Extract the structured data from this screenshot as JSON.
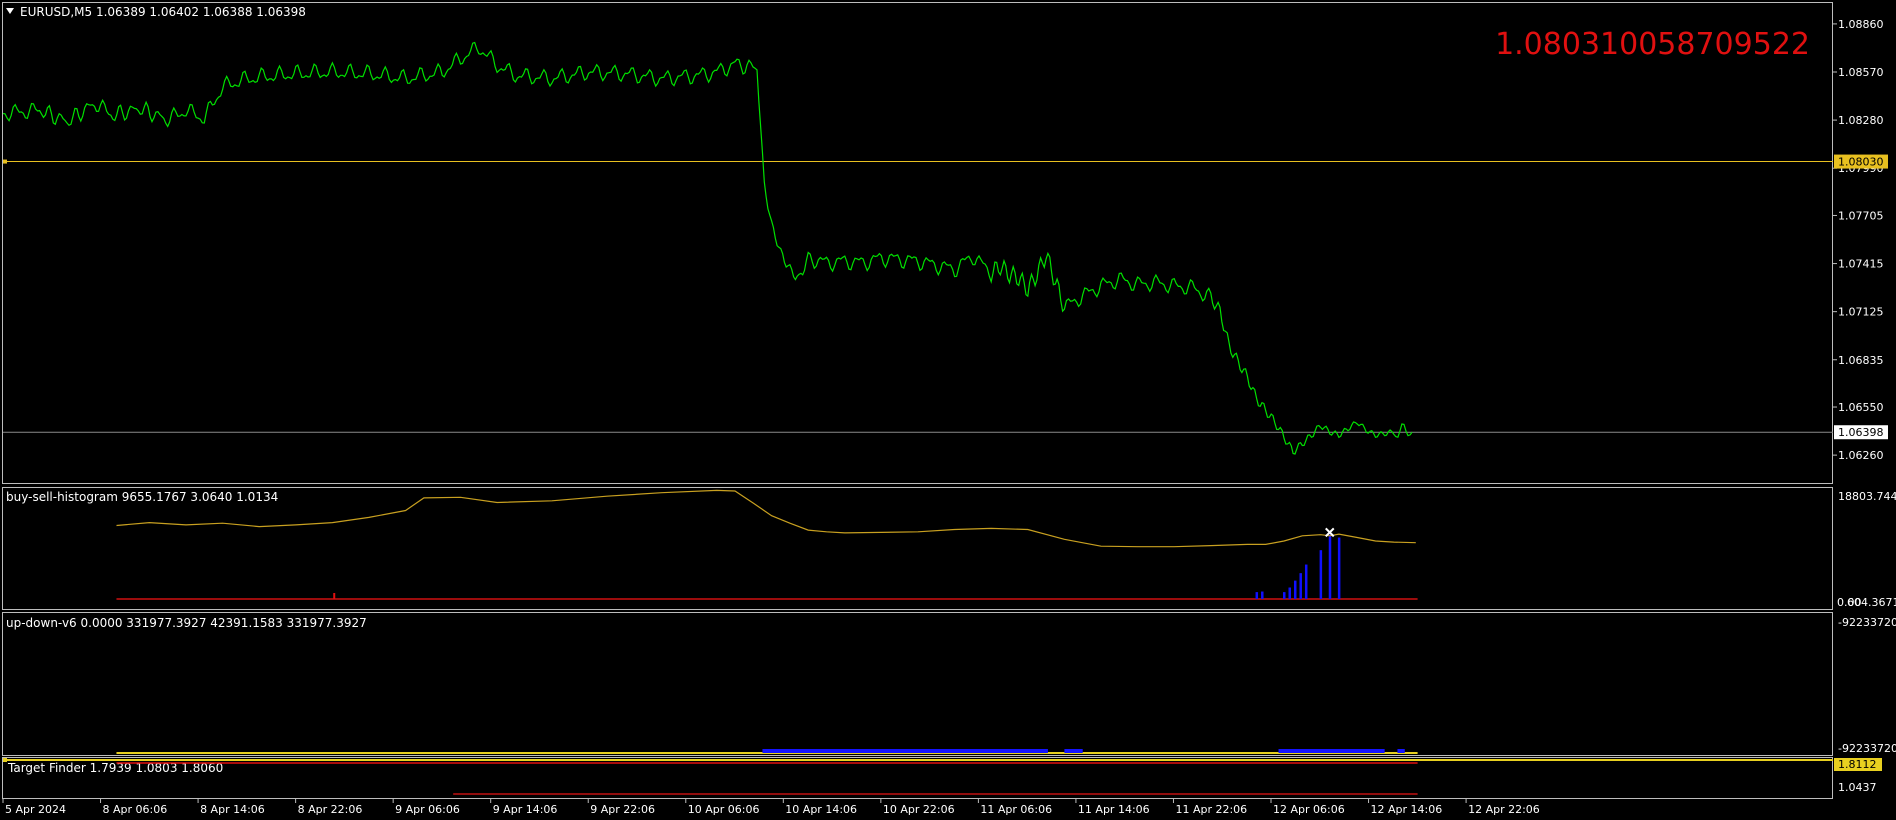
{
  "chart_data": [
    {
      "type": "line",
      "pane": "main",
      "title": "EURUSD,M5  1.06389 1.06402 1.06388 1.06398",
      "annotation": "1.080310058709522",
      "y_ticks": [
        "1.08860",
        "1.08570",
        "1.08280",
        "1.07990",
        "1.07705",
        "1.07415",
        "1.07125",
        "1.06835",
        "1.06550",
        "1.06260"
      ],
      "ylim": [
        1.0611,
        1.0898
      ],
      "x_ticks": [
        "5 Apr 2024",
        "8 Apr 06:06",
        "8 Apr 14:06",
        "8 Apr 22:06",
        "9 Apr 06:06",
        "9 Apr 14:06",
        "9 Apr 22:06",
        "10 Apr 06:06",
        "10 Apr 14:06",
        "10 Apr 22:06",
        "11 Apr 06:06",
        "11 Apr 14:06",
        "11 Apr 22:06",
        "12 Apr 06:06",
        "12 Apr 14:06",
        "12 Apr 22:06"
      ],
      "x_tick_fractions": [
        0.0,
        0.0533,
        0.1066,
        0.1599,
        0.2132,
        0.2665,
        0.3198,
        0.3731,
        0.4264,
        0.4797,
        0.533,
        0.5863,
        0.6396,
        0.6929,
        0.7462,
        0.7995
      ],
      "hlines": [
        {
          "name": "level",
          "value": 1.0803,
          "label": "1.08030",
          "color": "#e8c020"
        },
        {
          "name": "current-price",
          "value": 1.06398,
          "label": "1.06398",
          "color": "#8a8a8a"
        }
      ],
      "series": [
        {
          "color": "#00e000",
          "x_fraction": [
            0.0,
            0.02,
            0.035,
            0.05,
            0.06,
            0.075,
            0.09,
            0.1,
            0.11,
            0.12,
            0.13,
            0.14,
            0.16,
            0.18,
            0.2,
            0.22,
            0.24,
            0.25,
            0.26,
            0.27,
            0.28,
            0.3,
            0.32,
            0.34,
            0.36,
            0.38,
            0.39,
            0.4,
            0.412,
            0.414,
            0.416,
            0.42,
            0.425,
            0.43,
            0.435,
            0.44,
            0.45,
            0.46,
            0.47,
            0.48,
            0.5,
            0.52,
            0.53,
            0.54,
            0.545,
            0.55,
            0.555,
            0.56,
            0.565,
            0.57,
            0.575,
            0.58,
            0.59,
            0.6,
            0.61,
            0.62,
            0.63,
            0.64,
            0.65,
            0.66,
            0.665,
            0.67,
            0.675,
            0.68,
            0.685,
            0.69,
            0.695,
            0.7,
            0.705,
            0.71,
            0.715,
            0.72,
            0.725,
            0.73,
            0.735,
            0.74,
            0.745,
            0.75,
            0.755,
            0.76,
            0.77
          ],
          "values": [
            1.0832,
            1.0834,
            1.0827,
            1.0838,
            1.0831,
            1.0835,
            1.0828,
            1.0834,
            1.0829,
            1.0848,
            1.0852,
            1.0854,
            1.0856,
            1.0857,
            1.0856,
            1.0853,
            1.0857,
            1.0865,
            1.0872,
            1.0861,
            1.0855,
            1.0853,
            1.0857,
            1.0856,
            1.0853,
            1.0855,
            1.0857,
            1.0862,
            1.0859,
            1.0825,
            1.0789,
            1.0765,
            1.0748,
            1.0738,
            1.0732,
            1.0745,
            1.0742,
            1.0743,
            1.0742,
            1.0745,
            1.0743,
            1.0738,
            1.0746,
            1.0736,
            1.074,
            1.0735,
            1.0733,
            1.0726,
            1.0735,
            1.0747,
            1.0731,
            1.0715,
            1.0722,
            1.0728,
            1.0732,
            1.0729,
            1.073,
            1.0728,
            1.0727,
            1.0721,
            1.0713,
            1.0692,
            1.0682,
            1.0673,
            1.066,
            1.0653,
            1.0646,
            1.0637,
            1.0628,
            1.0633,
            1.0638,
            1.0644,
            1.064,
            1.0638,
            1.0642,
            1.0646,
            1.0641,
            1.0638,
            1.0639,
            1.064,
            1.06398
          ]
        }
      ]
    },
    {
      "type": "line",
      "pane": "indicator-1",
      "title": "buy-sell-histogram 9655.1767 3.0640 1.0134",
      "y_ticks": [
        "18803.744",
        "0.00",
        "604.3671"
      ],
      "ylim": [
        0,
        18803.744
      ],
      "series": [
        {
          "color": "#c8a020",
          "x_fraction": [
            0.062,
            0.08,
            0.1,
            0.12,
            0.14,
            0.16,
            0.18,
            0.2,
            0.22,
            0.23,
            0.25,
            0.27,
            0.3,
            0.33,
            0.36,
            0.39,
            0.4,
            0.41,
            0.42,
            0.43,
            0.44,
            0.45,
            0.46,
            0.48,
            0.5,
            0.52,
            0.54,
            0.56,
            0.58,
            0.6,
            0.62,
            0.64,
            0.66,
            0.68,
            0.69,
            0.7,
            0.71,
            0.72,
            0.725,
            0.73,
            0.74,
            0.75,
            0.76,
            0.772
          ],
          "values": [
            12800,
            13300,
            12900,
            13200,
            12600,
            12900,
            13300,
            14200,
            15400,
            17600,
            17700,
            16800,
            17100,
            17900,
            18500,
            18900,
            18800,
            16700,
            14500,
            13200,
            12000,
            11700,
            11500,
            11600,
            11700,
            12100,
            12300,
            12100,
            10400,
            9200,
            9100,
            9100,
            9300,
            9500,
            9500,
            10100,
            11000,
            11200,
            11000,
            11300,
            10700,
            10100,
            9900,
            9800
          ]
        }
      ],
      "bars": {
        "color": "#1010ff",
        "x_fraction": [
          0.685,
          0.688,
          0.7,
          0.703,
          0.706,
          0.709,
          0.712,
          0.72,
          0.725,
          0.73
        ],
        "values": [
          1200,
          1300,
          1200,
          2000,
          3200,
          4500,
          6000,
          8500,
          11200,
          10700
        ]
      },
      "markers": [
        {
          "symbol": "x",
          "x_fraction": 0.725,
          "value": 11600,
          "color": "#ffffff"
        }
      ]
    },
    {
      "type": "line",
      "pane": "indicator-2",
      "title": "up-down-v6 0.0000 331977.3927 42391.1583 331977.3927",
      "y_ticks": [
        "-92233720",
        "-92233720"
      ],
      "segments": [
        {
          "color": "#1414ff",
          "x_fraction_start": 0.415,
          "x_fraction_end": 0.571
        },
        {
          "color": "#1414ff",
          "x_fraction_start": 0.58,
          "x_fraction_end": 0.59
        },
        {
          "color": "#1414ff",
          "x_fraction_start": 0.697,
          "x_fraction_end": 0.755
        },
        {
          "color": "#1414ff",
          "x_fraction_start": 0.762,
          "x_fraction_end": 0.766
        }
      ],
      "baseline_color": "#e8d020"
    },
    {
      "type": "line",
      "pane": "indicator-3",
      "title": "Target Finder 1.7939 1.0803 1.8060",
      "y_ticks": [
        "1.8112",
        "1.0437"
      ],
      "segments": [
        {
          "color": "#e01010",
          "x_fraction_start": 0.062,
          "x_fraction_end": 0.773,
          "position": "top"
        },
        {
          "color": "#c01010",
          "x_fraction_start": 0.246,
          "x_fraction_end": 0.773,
          "position": "bottom"
        }
      ]
    }
  ]
}
